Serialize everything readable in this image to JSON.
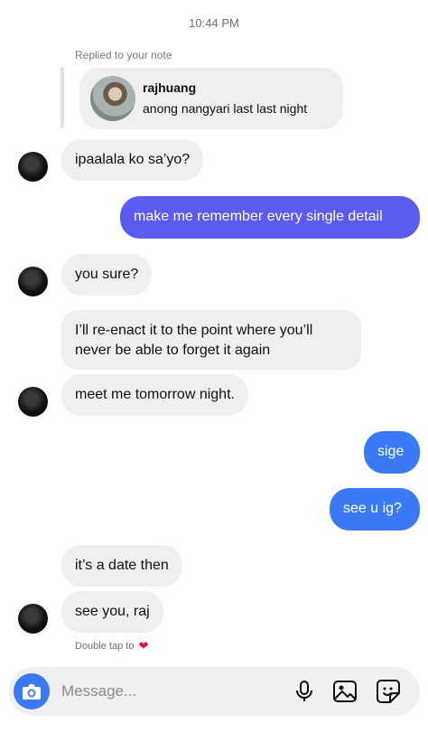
{
  "thread": {
    "timestamp": "10:44 PM",
    "reply_label": "Replied to your note",
    "note": {
      "username": "rajhuang",
      "text": "anong nangyari last last night"
    },
    "messages": [
      {
        "from": "them",
        "text": "ipaalala ko sa’yo?"
      },
      {
        "from": "me",
        "text": "make me remember every single detail"
      },
      {
        "from": "them",
        "text": "you sure?"
      },
      {
        "from": "them",
        "text": "I’ll re-enact it to the point where you’ll never be able to forget it again"
      },
      {
        "from": "them",
        "text": "meet me tomorrow night."
      },
      {
        "from": "me",
        "text": "sige"
      },
      {
        "from": "me",
        "text": "see u ig?"
      },
      {
        "from": "them",
        "text": "it’s a date then"
      },
      {
        "from": "them",
        "text": "see you, raj"
      }
    ],
    "double_tap_hint": "Double tap to",
    "heart_glyph": "❤"
  },
  "composer": {
    "placeholder": "Message...",
    "icons": [
      "camera-icon",
      "microphone-icon",
      "gallery-icon",
      "sticker-icon"
    ]
  },
  "colors": {
    "outgoing_purple": "#5b5bf0",
    "outgoing_blue": "#3a7bf5",
    "incoming": "#efeff2",
    "heart": "#e0182d"
  }
}
